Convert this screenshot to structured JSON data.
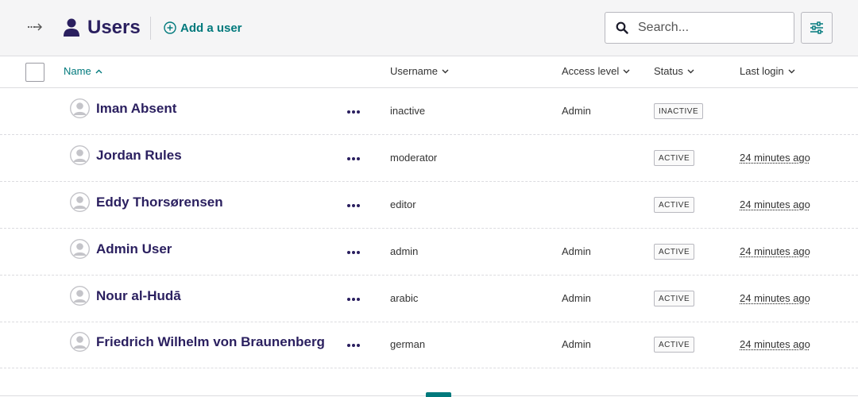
{
  "header": {
    "title": "Users",
    "add_user_label": "Add a user",
    "search_placeholder": "Search..."
  },
  "table": {
    "columns": {
      "name": "Name",
      "username": "Username",
      "access_level": "Access level",
      "status": "Status",
      "last_login": "Last login"
    },
    "sorted_by": "name",
    "sort_direction": "ascending",
    "rows": [
      {
        "name": "Iman Absent",
        "username": "inactive",
        "access": "Admin",
        "status": "INACTIVE",
        "last_login": ""
      },
      {
        "name": "Jordan Rules",
        "username": "moderator",
        "access": "",
        "status": "ACTIVE",
        "last_login": "24 minutes ago"
      },
      {
        "name": "Eddy Thorsørensen",
        "username": "editor",
        "access": "",
        "status": "ACTIVE",
        "last_login": "24 minutes ago"
      },
      {
        "name": "Admin User",
        "username": "admin",
        "access": "Admin",
        "status": "ACTIVE",
        "last_login": "24 minutes ago"
      },
      {
        "name": "Nour al-Hudā",
        "username": "arabic",
        "access": "Admin",
        "status": "ACTIVE",
        "last_login": "24 minutes ago"
      },
      {
        "name": "Friedrich Wilhelm von Braunenberg",
        "username": "german",
        "access": "Admin",
        "status": "ACTIVE",
        "last_login": "24 minutes ago"
      }
    ]
  },
  "colors": {
    "accent": "#00797c",
    "title": "#2a1f5f",
    "header_bg": "#f5f5f6"
  },
  "icons": {
    "toggle": "sidebar-toggle-arrow-icon",
    "page": "user-icon",
    "add": "plus-circle-icon",
    "search": "search-icon",
    "filter": "sliders-icon",
    "row_avatar": "avatar-icon",
    "row_menu": "more-dots-icon"
  }
}
